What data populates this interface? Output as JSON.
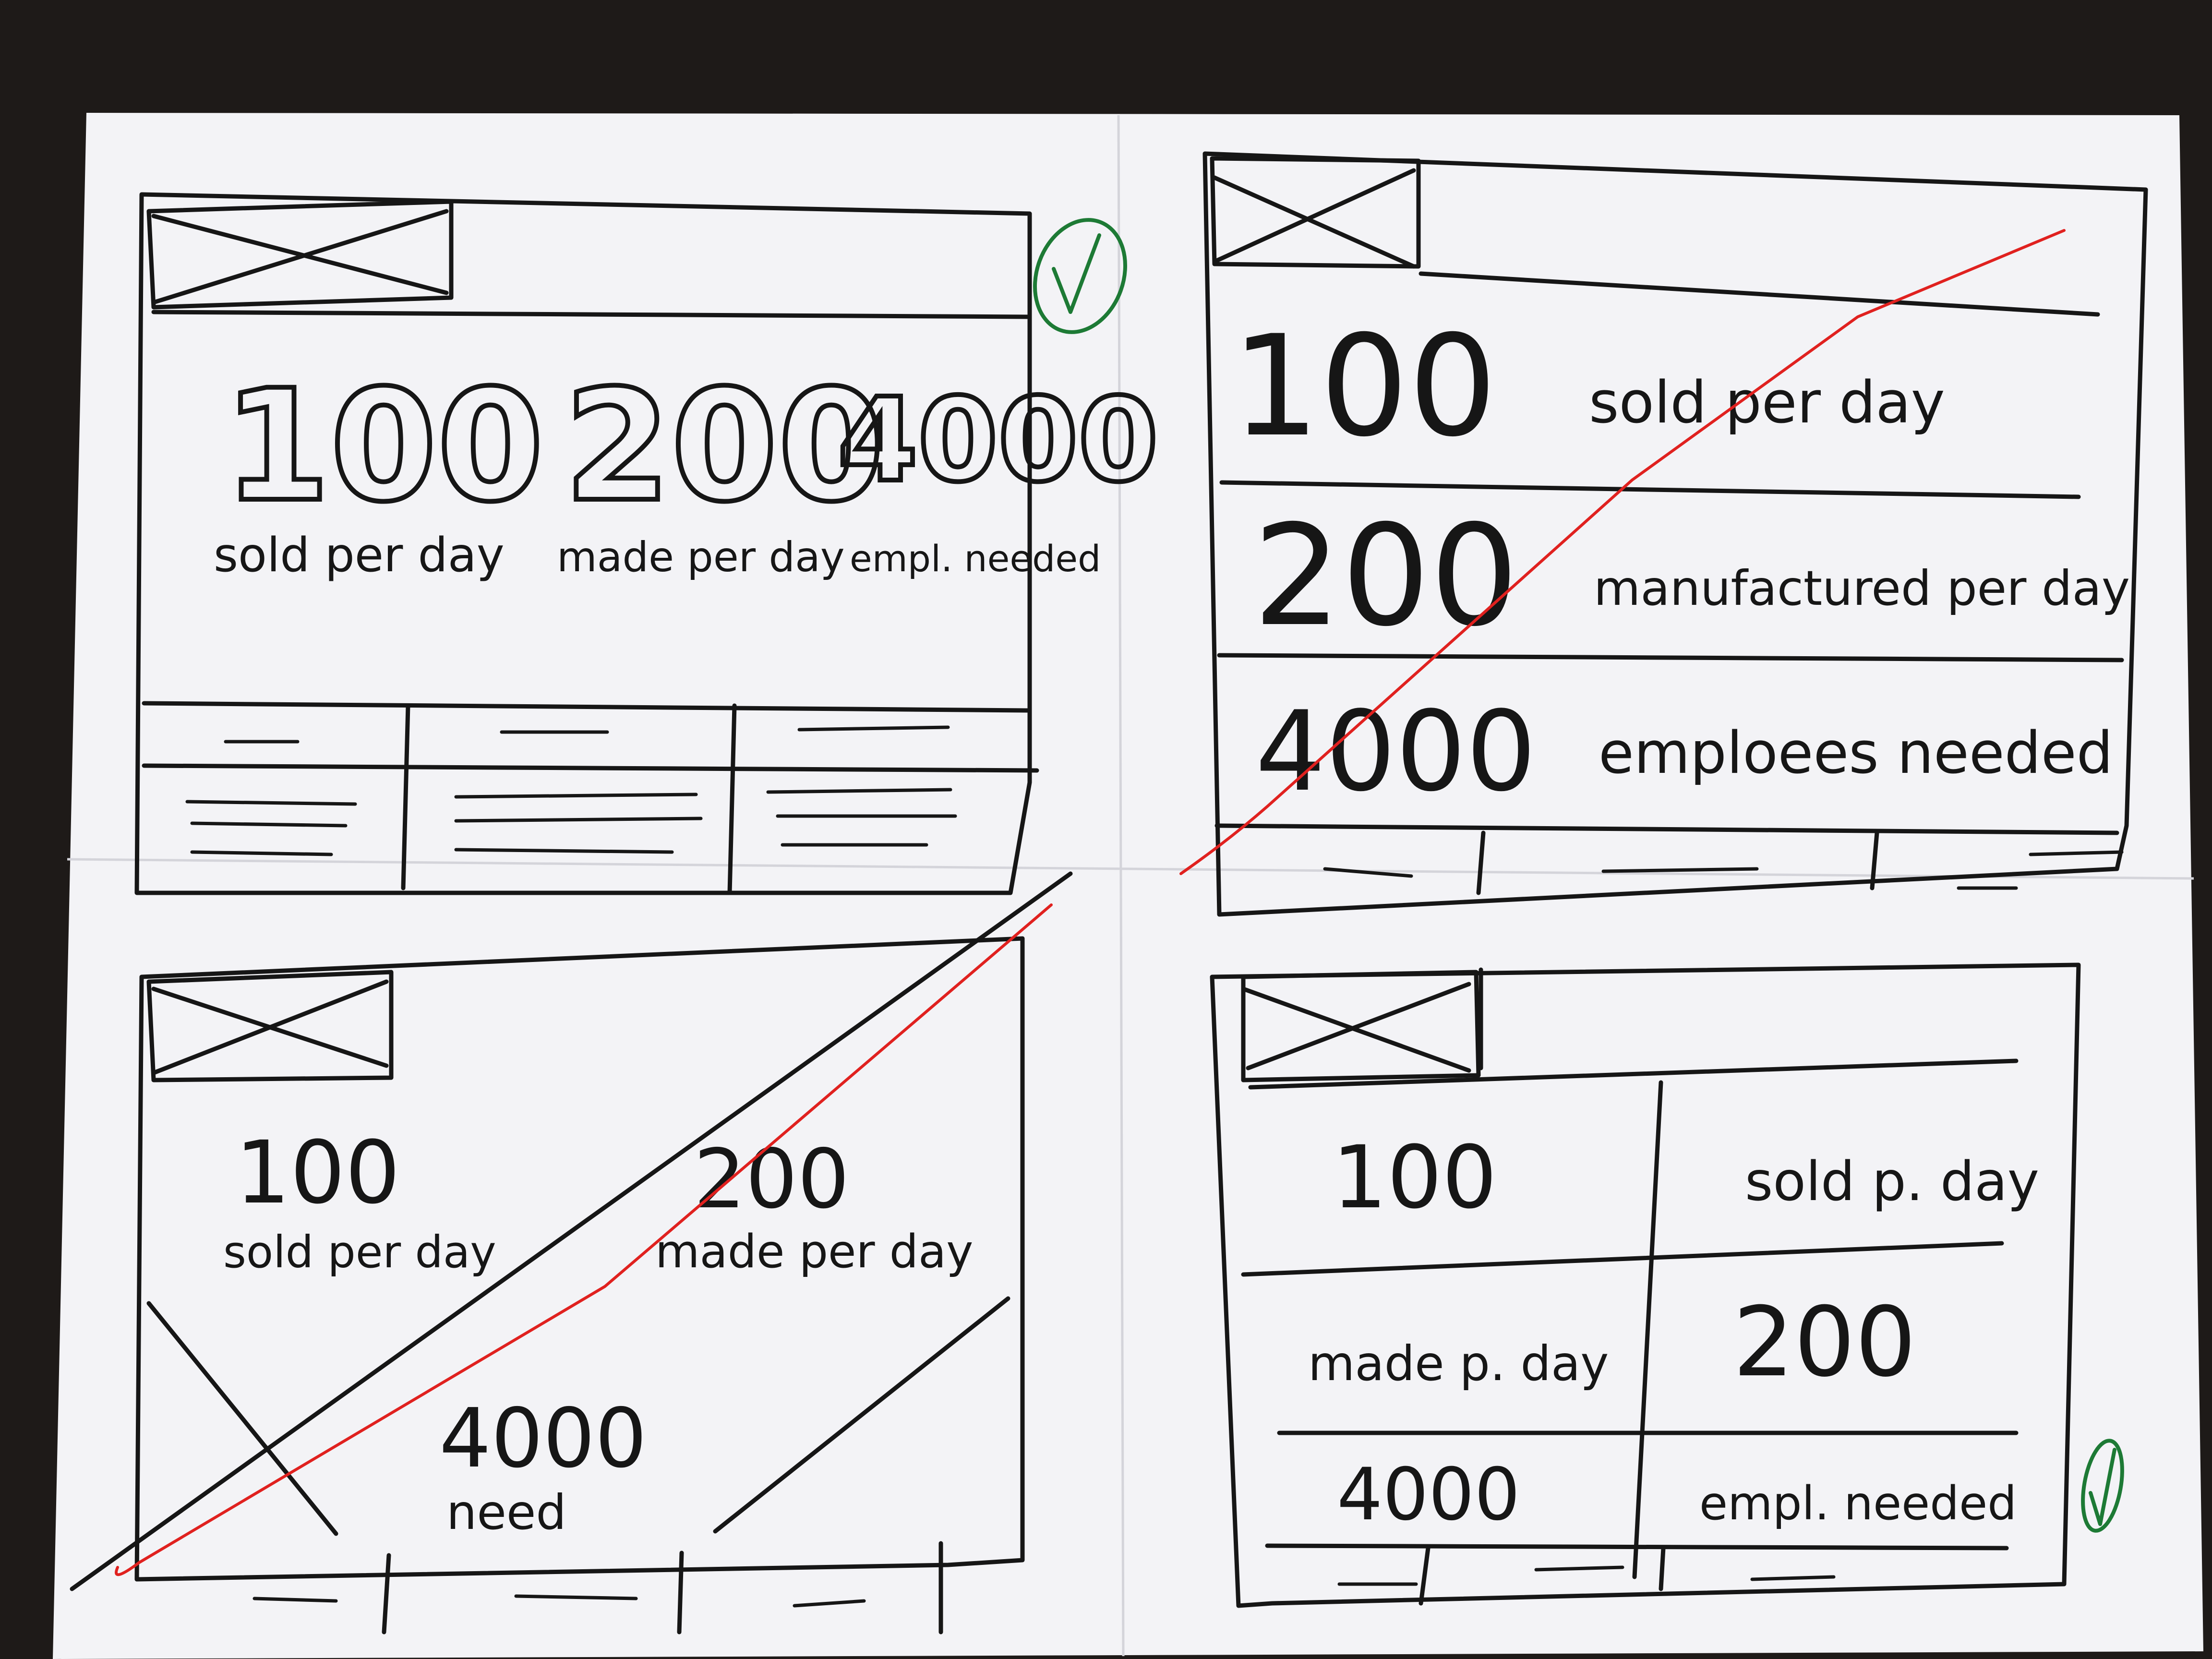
{
  "sketch1": {
    "stats": [
      {
        "value": "100",
        "label": "sold per day"
      },
      {
        "value": "200",
        "label": "made per day"
      },
      {
        "value": "4000",
        "label": "empl. needed"
      }
    ],
    "approved": true
  },
  "sketch2": {
    "rows": [
      {
        "value": "100",
        "label": "sold per day"
      },
      {
        "value": "200",
        "label": "manufactured per day"
      },
      {
        "value": "4000",
        "label": "emploees needed"
      }
    ],
    "rejected": true
  },
  "sketch3": {
    "stats": [
      {
        "value": "100",
        "label": "sold per day"
      },
      {
        "value": "200",
        "label": "made per day"
      },
      {
        "value": "4000",
        "label": "need"
      }
    ],
    "rejected": true
  },
  "sketch4": {
    "rows": [
      {
        "left": "100",
        "right": "sold p. day"
      },
      {
        "left": "made p. day",
        "right": "200"
      },
      {
        "left": "4000",
        "right": "empl. needed"
      }
    ],
    "approved": true
  },
  "colors": {
    "ink": "#161616",
    "reject_mark": "#e0211f",
    "approve_mark": "#1d7a35",
    "paper": "#f3f3f6",
    "table": "#1e1a18"
  },
  "icons": [
    "image-placeholder-icon",
    "checkmark-icon",
    "strike-through-line"
  ]
}
